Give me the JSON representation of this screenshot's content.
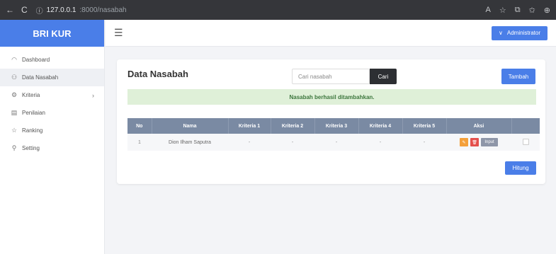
{
  "browser": {
    "back": "←",
    "reload": "C",
    "info": "ⓘ",
    "url_host": "127.0.0.1",
    "url_path": ":8000/nasabah",
    "icons": [
      "A",
      "☆",
      "⧉",
      "✩",
      "⊕"
    ]
  },
  "sidebar": {
    "brand": "BRI KUR",
    "items": [
      {
        "label": "Dashboard",
        "icon": "◠"
      },
      {
        "label": "Data Nasabah",
        "icon": "⚇"
      },
      {
        "label": "Kriteria",
        "icon": "⚙",
        "chevron": "›"
      },
      {
        "label": "Penilaian",
        "icon": "▤"
      },
      {
        "label": "Ranking",
        "icon": "☆"
      },
      {
        "label": "Setting",
        "icon": "⚲"
      }
    ]
  },
  "header": {
    "menu_icon": "☰",
    "user_chevron": "∨",
    "user": "Administrator"
  },
  "main": {
    "title": "Data Nasabah",
    "search_placeholder": "Cari nasabah",
    "search_button": "Cari",
    "add_button": "Tambah",
    "alert": "Nasabah berhasil ditambahkan.",
    "table": {
      "headers": [
        "No",
        "Nama",
        "Kriteria 1",
        "Kriteria 2",
        "Kriteria 3",
        "Kriteria 4",
        "Kriteria 5",
        "Aksi",
        ""
      ],
      "rows": [
        {
          "no": "1",
          "nama": "Dion Ilham Saputra",
          "k1": "-",
          "k2": "-",
          "k3": "-",
          "k4": "-",
          "k5": "-",
          "edit": "✎",
          "delete": "🗑",
          "input": "Input"
        }
      ]
    },
    "hitung_button": "Hitung"
  },
  "colors": {
    "primary": "#4a7ee8",
    "table_header": "#7a8aa3",
    "alert_bg": "#dff0d8",
    "alert_text": "#3c763d",
    "edit": "#f4a03a",
    "delete": "#e4504c"
  }
}
